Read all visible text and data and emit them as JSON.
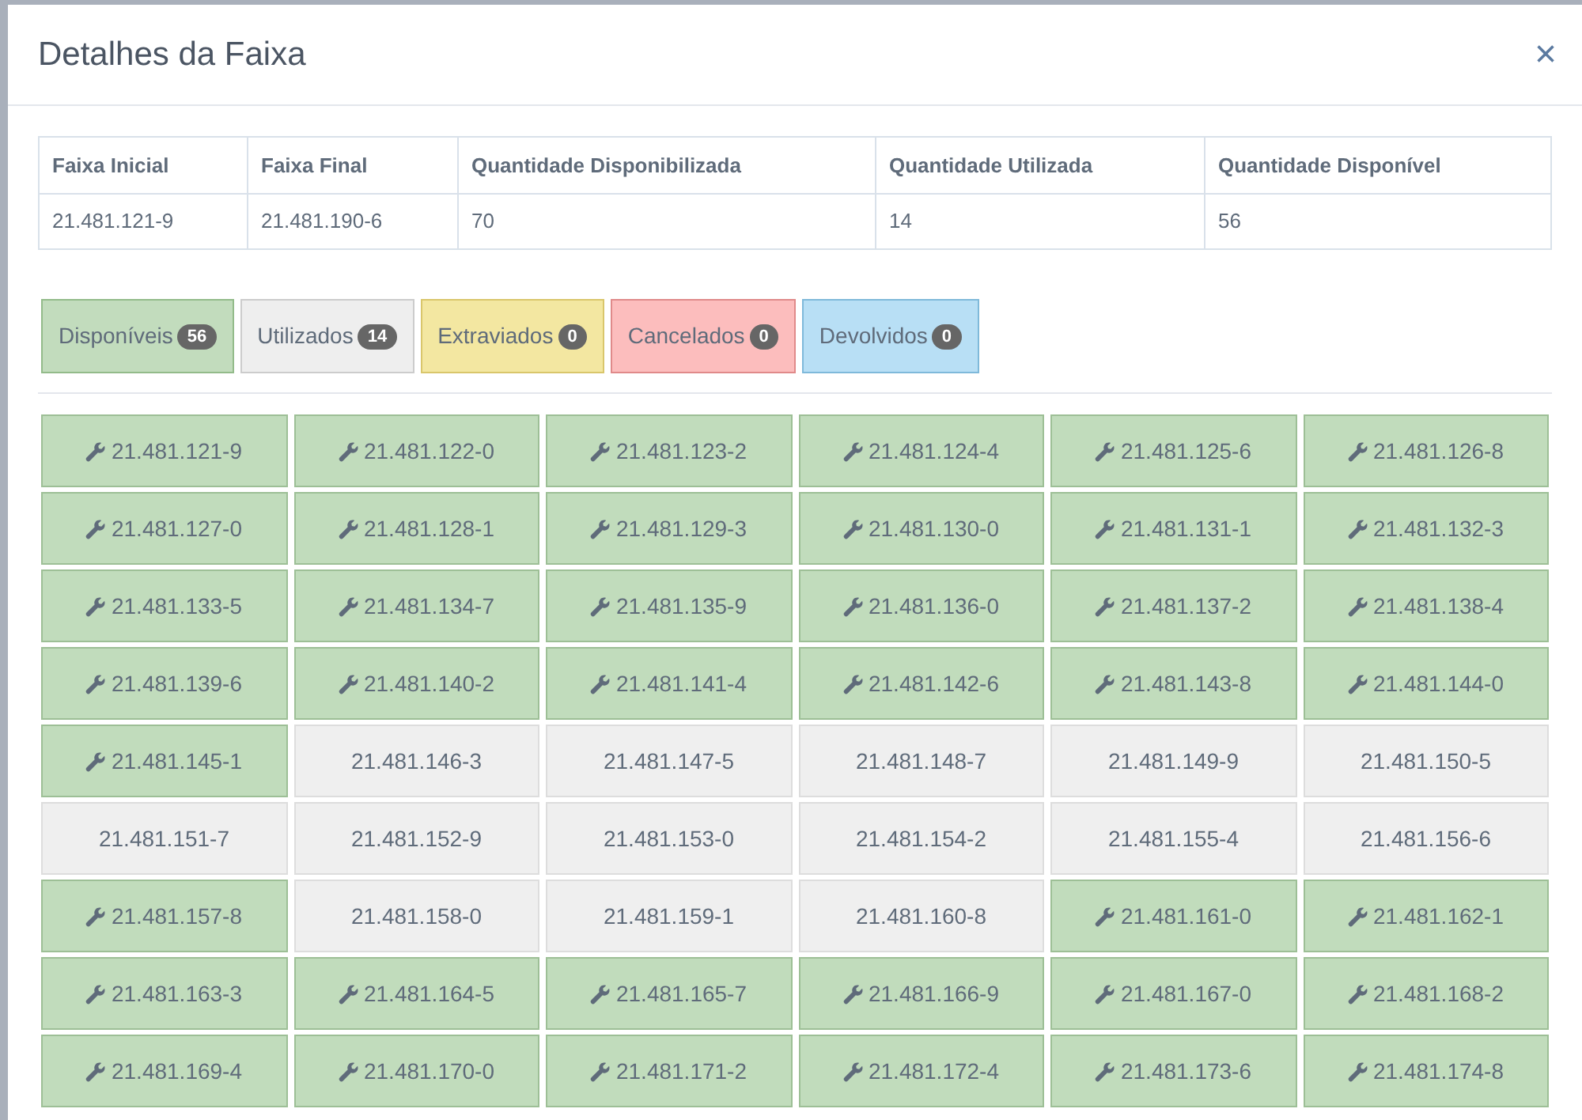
{
  "modal": {
    "title": "Detalhes da Faixa",
    "close": "×"
  },
  "summary": {
    "columns": [
      "Faixa Inicial",
      "Faixa Final",
      "Quantidade Disponibilizada",
      "Quantidade Utilizada",
      "Quantidade Disponível"
    ],
    "row": [
      "21.481.121-9",
      "21.481.190-6",
      "70",
      "14",
      "56"
    ]
  },
  "filters": [
    {
      "label": "Disponíveis",
      "count": "56",
      "kind": "available"
    },
    {
      "label": "Utilizados",
      "count": "14",
      "kind": "used"
    },
    {
      "label": "Extraviados",
      "count": "0",
      "kind": "lost"
    },
    {
      "label": "Cancelados",
      "count": "0",
      "kind": "cancelled"
    },
    {
      "label": "Devolvidos",
      "count": "0",
      "kind": "returned"
    }
  ],
  "tiles": [
    {
      "number": "21.481.121-9",
      "kind": "available"
    },
    {
      "number": "21.481.122-0",
      "kind": "available"
    },
    {
      "number": "21.481.123-2",
      "kind": "available"
    },
    {
      "number": "21.481.124-4",
      "kind": "available"
    },
    {
      "number": "21.481.125-6",
      "kind": "available"
    },
    {
      "number": "21.481.126-8",
      "kind": "available"
    },
    {
      "number": "21.481.127-0",
      "kind": "available"
    },
    {
      "number": "21.481.128-1",
      "kind": "available"
    },
    {
      "number": "21.481.129-3",
      "kind": "available"
    },
    {
      "number": "21.481.130-0",
      "kind": "available"
    },
    {
      "number": "21.481.131-1",
      "kind": "available"
    },
    {
      "number": "21.481.132-3",
      "kind": "available"
    },
    {
      "number": "21.481.133-5",
      "kind": "available"
    },
    {
      "number": "21.481.134-7",
      "kind": "available"
    },
    {
      "number": "21.481.135-9",
      "kind": "available"
    },
    {
      "number": "21.481.136-0",
      "kind": "available"
    },
    {
      "number": "21.481.137-2",
      "kind": "available"
    },
    {
      "number": "21.481.138-4",
      "kind": "available"
    },
    {
      "number": "21.481.139-6",
      "kind": "available"
    },
    {
      "number": "21.481.140-2",
      "kind": "available"
    },
    {
      "number": "21.481.141-4",
      "kind": "available"
    },
    {
      "number": "21.481.142-6",
      "kind": "available"
    },
    {
      "number": "21.481.143-8",
      "kind": "available"
    },
    {
      "number": "21.481.144-0",
      "kind": "available"
    },
    {
      "number": "21.481.145-1",
      "kind": "available"
    },
    {
      "number": "21.481.146-3",
      "kind": "used"
    },
    {
      "number": "21.481.147-5",
      "kind": "used"
    },
    {
      "number": "21.481.148-7",
      "kind": "used"
    },
    {
      "number": "21.481.149-9",
      "kind": "used"
    },
    {
      "number": "21.481.150-5",
      "kind": "used"
    },
    {
      "number": "21.481.151-7",
      "kind": "used"
    },
    {
      "number": "21.481.152-9",
      "kind": "used"
    },
    {
      "number": "21.481.153-0",
      "kind": "used"
    },
    {
      "number": "21.481.154-2",
      "kind": "used"
    },
    {
      "number": "21.481.155-4",
      "kind": "used"
    },
    {
      "number": "21.481.156-6",
      "kind": "used"
    },
    {
      "number": "21.481.157-8",
      "kind": "available"
    },
    {
      "number": "21.481.158-0",
      "kind": "used"
    },
    {
      "number": "21.481.159-1",
      "kind": "used"
    },
    {
      "number": "21.481.160-8",
      "kind": "used"
    },
    {
      "number": "21.481.161-0",
      "kind": "available"
    },
    {
      "number": "21.481.162-1",
      "kind": "available"
    },
    {
      "number": "21.481.163-3",
      "kind": "available"
    },
    {
      "number": "21.481.164-5",
      "kind": "available"
    },
    {
      "number": "21.481.165-7",
      "kind": "available"
    },
    {
      "number": "21.481.166-9",
      "kind": "available"
    },
    {
      "number": "21.481.167-0",
      "kind": "available"
    },
    {
      "number": "21.481.168-2",
      "kind": "available"
    },
    {
      "number": "21.481.169-4",
      "kind": "available"
    },
    {
      "number": "21.481.170-0",
      "kind": "available"
    },
    {
      "number": "21.481.171-2",
      "kind": "available"
    },
    {
      "number": "21.481.172-4",
      "kind": "available"
    },
    {
      "number": "21.481.173-6",
      "kind": "available"
    },
    {
      "number": "21.481.174-8",
      "kind": "available"
    }
  ]
}
